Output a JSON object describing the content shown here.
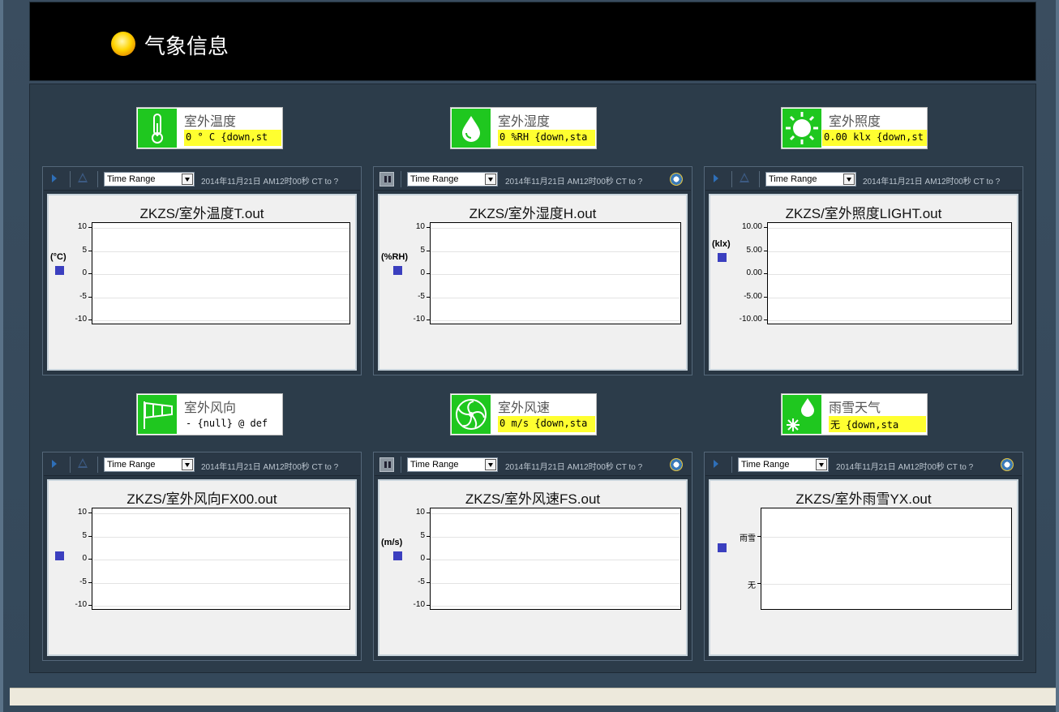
{
  "header": {
    "title": "气象信息"
  },
  "tiles": [
    {
      "label": "室外温度",
      "value": "0 ° C {down,st",
      "icon": "thermometer-icon"
    },
    {
      "label": "室外湿度",
      "value": "0 %RH {down,sta",
      "icon": "droplet-icon"
    },
    {
      "label": "室外照度",
      "value": "0.00 klx {down,st",
      "icon": "sun-icon"
    },
    {
      "label": "室外风向",
      "value": "- {null} @ def",
      "icon": "windsock-icon"
    },
    {
      "label": "室外风速",
      "value": "0 m/s {down,sta",
      "icon": "fan-icon"
    },
    {
      "label": "雨雪天气",
      "value": " 无 {down,sta",
      "icon": "rain-snow-icon"
    }
  ],
  "toolbar": {
    "range_label": "Time Range",
    "range_text": "2014年11月21日 AM12时00秒 CT to ?"
  },
  "charts": [
    {
      "title": "ZKZS/室外温度T.out",
      "unit": "(°C)",
      "ticks": [
        "10",
        "5",
        "0",
        "-5",
        "-10"
      ]
    },
    {
      "title": "ZKZS/室外湿度H.out",
      "unit": "(%RH)",
      "ticks": [
        "10",
        "5",
        "0",
        "-5",
        "-10"
      ]
    },
    {
      "title": "ZKZS/室外照度LIGHT.out",
      "unit": "(klx)",
      "ticks": [
        "10.00",
        "5.00",
        "0.00",
        "-5.00",
        "-10.00"
      ]
    },
    {
      "title": "ZKZS/室外风向FX00.out",
      "unit": "",
      "ticks": [
        "10",
        "5",
        "0",
        "-5",
        "-10"
      ]
    },
    {
      "title": "ZKZS/室外风速FS.out",
      "unit": "(m/s)",
      "ticks": [
        "10",
        "5",
        "0",
        "-5",
        "-10"
      ]
    },
    {
      "title": "ZKZS/室外雨雪YX.out",
      "unit": "",
      "ticks": [
        "雨雪",
        "无"
      ]
    }
  ],
  "colors": {
    "tile_icon_bg": "#1fc71f",
    "value_highlight": "#ffff30",
    "legend": "#3b3fbf"
  }
}
